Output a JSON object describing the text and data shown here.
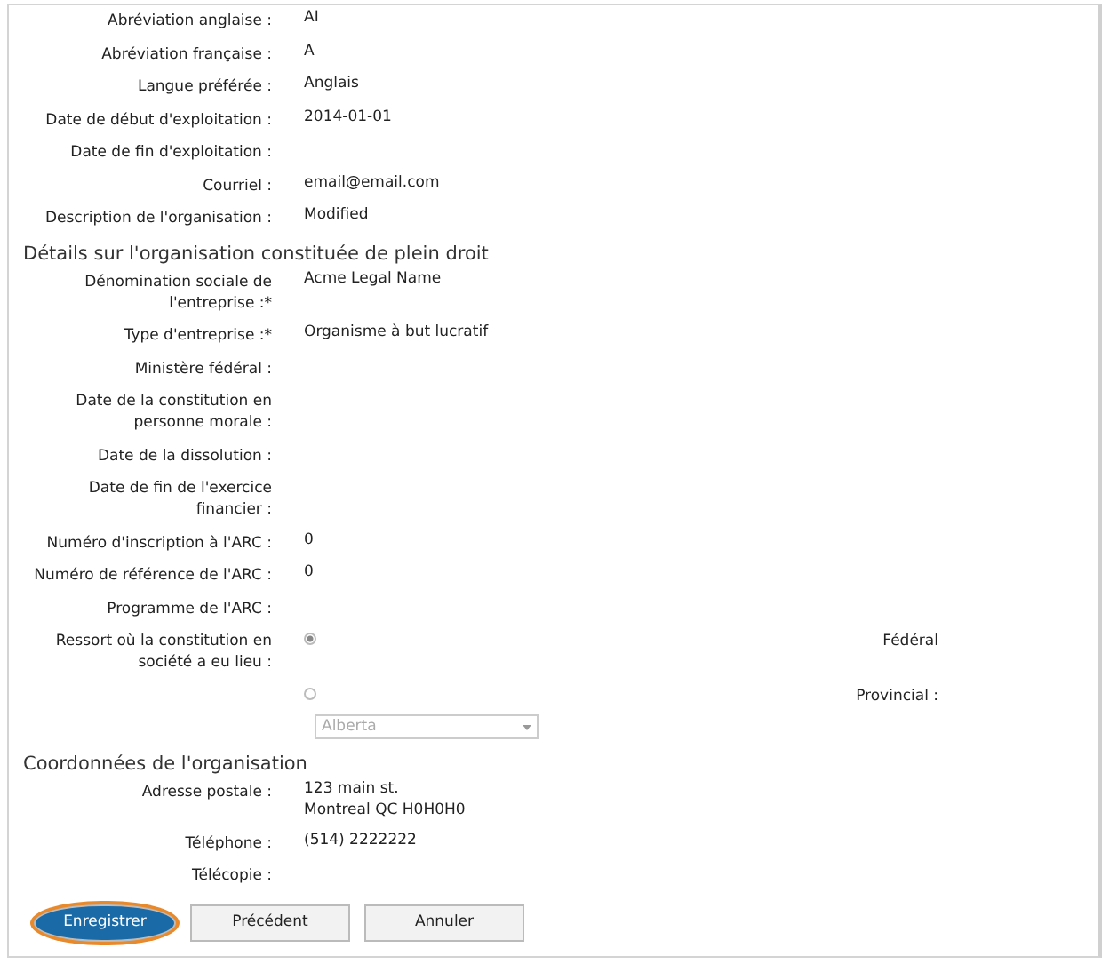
{
  "sections": [
    {
      "fields": [
        {
          "label": "Abréviation anglaise :",
          "value": "AI"
        },
        {
          "label": "Abréviation française :",
          "value": "A"
        },
        {
          "label": "Langue préférée :",
          "value": "Anglais"
        },
        {
          "label": "Date de début d'exploitation :",
          "value": "2014-01-01"
        },
        {
          "label": "Date de fin d'exploitation :"
        },
        {
          "label": "Courriel :",
          "value": "email@email.com"
        },
        {
          "label": "Description de l'organisation :",
          "value": "Modified"
        }
      ]
    },
    {
      "title": "Détails sur l'organisation constituée de plein droit",
      "fields": [
        {
          "label": "Dénomination sociale de l'entreprise :*",
          "value": "Acme Legal Name"
        },
        {
          "label": "Type d'entreprise :*",
          "value": "Organisme à but lucratif"
        },
        {
          "label": "Ministère fédéral :"
        },
        {
          "label": "Date de la constitution en personne morale :"
        },
        {
          "label": "Date de la dissolution :"
        },
        {
          "label": "Date de fin de l'exercice financier :"
        },
        {
          "label": "Numéro d'inscription à l'ARC :",
          "value": "0"
        },
        {
          "label": "Numéro de référence de l'ARC :",
          "value": "0"
        },
        {
          "label": "Programme de l'ARC :"
        }
      ],
      "jurisdiction": {
        "label": "Ressort où la constitution en société a eu lieu :",
        "options": [
          {
            "label": "Fédéral",
            "selected": true
          },
          {
            "label": "Provincial :",
            "selected": false
          }
        ],
        "select": {
          "value": "Alberta",
          "disabled": true
        }
      }
    },
    {
      "title": "Coordonnées de l'organisation",
      "fields": [
        {
          "label": "Adresse postale :",
          "value": "123 main st.\nMontreal QC H0H0H0"
        },
        {
          "label": "Téléphone :",
          "value": "(514) 2222222"
        },
        {
          "label": "Télécopie :"
        }
      ]
    }
  ],
  "buttons": [
    {
      "label": "Enregistrer",
      "kind": "primary",
      "highlighted": true
    },
    {
      "label": "Précédent",
      "kind": "secondary",
      "highlighted": false
    },
    {
      "label": "Annuler",
      "kind": "secondary",
      "highlighted": false
    }
  ]
}
